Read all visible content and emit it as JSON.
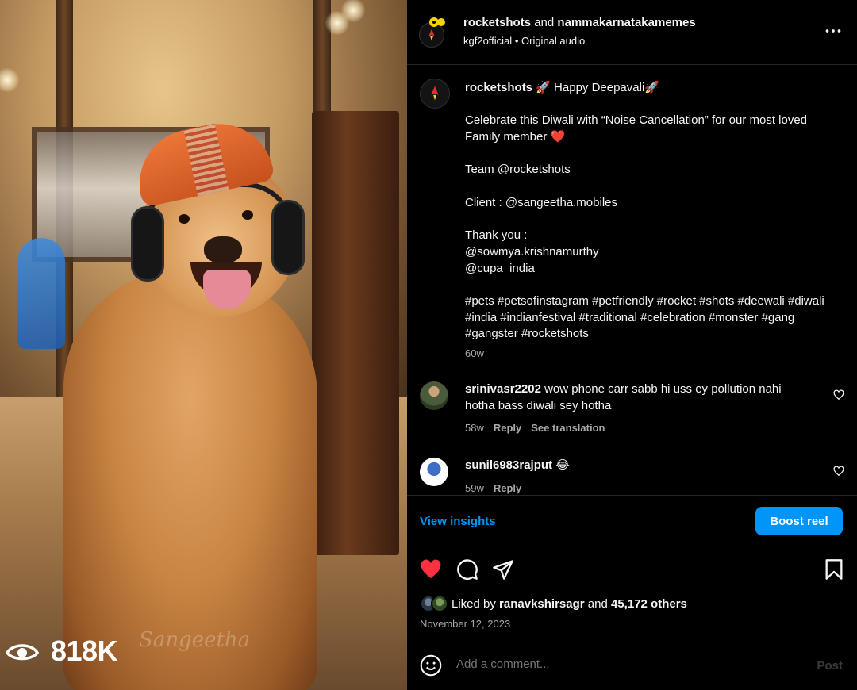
{
  "media": {
    "views": "818K",
    "watermark": "Sangeetha"
  },
  "header": {
    "user1": "rocketshots",
    "conj": "and",
    "user2": "nammakarnatakamemes",
    "audio_user": "kgf2official",
    "separator": "•",
    "audio": "Original audio",
    "more": "•••"
  },
  "caption": {
    "user": "rocketshots",
    "headline": "🚀 Happy Deepavali🚀",
    "line1": "Celebrate this Diwali with “Noise Cancellation” for our most loved Family member ❤️",
    "line2": "Team @rocketshots",
    "line3": "Client : @sangeetha.mobiles",
    "thanks": "Thank you :",
    "thanks1": "@sowmya.krishnamurthy",
    "thanks2": "@cupa_india",
    "hashtags": "#pets #petsofinstagram #petfriendly #rocket #shots #deewali #diwali #india #indianfestival #traditional #celebration #monster #gang #gangster #rocketshots",
    "time": "60w"
  },
  "comments": [
    {
      "user": "srinivasr2202",
      "text": "wow phone carr sabb hi uss ey pollution nahi hotha bass diwali sey hotha",
      "time": "58w",
      "reply": "Reply",
      "translate": "See translation"
    },
    {
      "user": "sunil6983rajput",
      "text": "😂",
      "time": "59w",
      "reply": "Reply"
    }
  ],
  "insights": {
    "view": "View insights",
    "boost": "Boost reel"
  },
  "likes": {
    "prefix": "Liked by",
    "user": "ranavkshirsagr",
    "and": "and",
    "others": "45,172 others",
    "date": "November 12, 2023"
  },
  "add_comment": {
    "placeholder": "Add a comment...",
    "post": "Post"
  },
  "colors": {
    "accent": "#0095f6",
    "like": "#ff3040",
    "muted": "#a8a8a8"
  },
  "icons": [
    "eye-icon",
    "more-icon",
    "heart-icon",
    "comment-icon",
    "share-icon",
    "bookmark-icon",
    "emoji-icon"
  ]
}
